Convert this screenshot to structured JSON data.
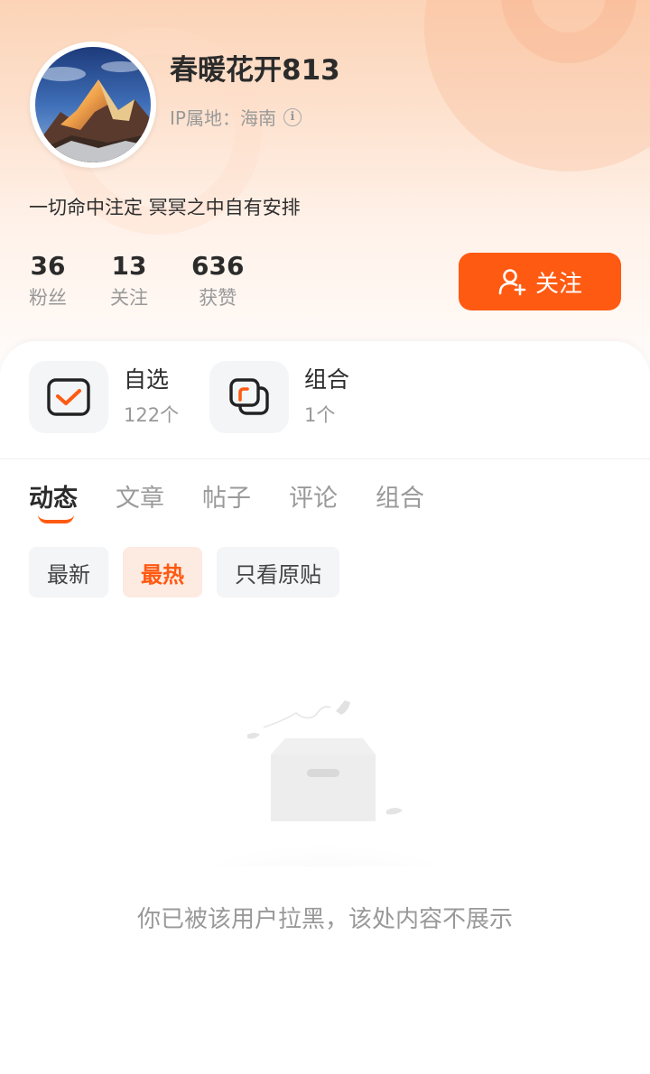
{
  "profile": {
    "username": "春暖花开813",
    "ip_label": "IP属地：海南",
    "bio": "一切命中注定 冥冥之中自有安排"
  },
  "stats": [
    {
      "num": "36",
      "label": "粉丝"
    },
    {
      "num": "13",
      "label": "关注"
    },
    {
      "num": "636",
      "label": "获赞"
    }
  ],
  "follow_button": {
    "label": "关注",
    "icon": "add-user-icon"
  },
  "shortcuts": [
    {
      "title": "自选",
      "count": "122个",
      "icon": "checkbox-icon"
    },
    {
      "title": "组合",
      "count": "1个",
      "icon": "portfolio-icon"
    }
  ],
  "tabs": [
    "动态",
    "文章",
    "帖子",
    "评论",
    "组合"
  ],
  "active_tab": "动态",
  "filters": [
    "最新",
    "最热",
    "只看原贴"
  ],
  "active_filter": "最热",
  "empty_state": {
    "message": "你已被该用户拉黑，该处内容不展示",
    "icon": "empty-box-icon"
  },
  "colors": {
    "accent": "#ff5a12",
    "accent_light": "#fdeae1"
  }
}
